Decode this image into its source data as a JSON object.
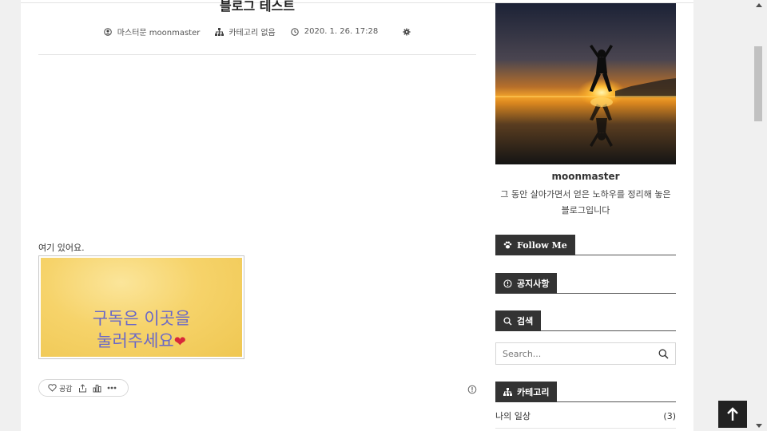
{
  "post": {
    "title": "블로그 테스트",
    "author": "마스터문 moonmaster",
    "category": "카테고리 없음",
    "date": "2020. 1. 26. 17:28",
    "body_text": "여기 있어요.",
    "banner_line1": "구독은 이곳을",
    "banner_line2": "눌러주세요",
    "like_label": "공감"
  },
  "sidebar": {
    "blog_name": "moonmaster",
    "blog_desc": "그 동안 살아가면서 얻은 노하우를 정리해 놓은 블로그입니다",
    "follow_title": "Follow Me",
    "notice_title": "공지사항",
    "search_title": "검색",
    "search_placeholder": "Search...",
    "category_title": "카테고리",
    "categories": [
      {
        "name": "나의 일상",
        "count": "(3)"
      }
    ]
  },
  "colors": {
    "widget_tab": "#333333",
    "banner_text": "#6a68c8",
    "banner_bg": "#f6d36a"
  }
}
